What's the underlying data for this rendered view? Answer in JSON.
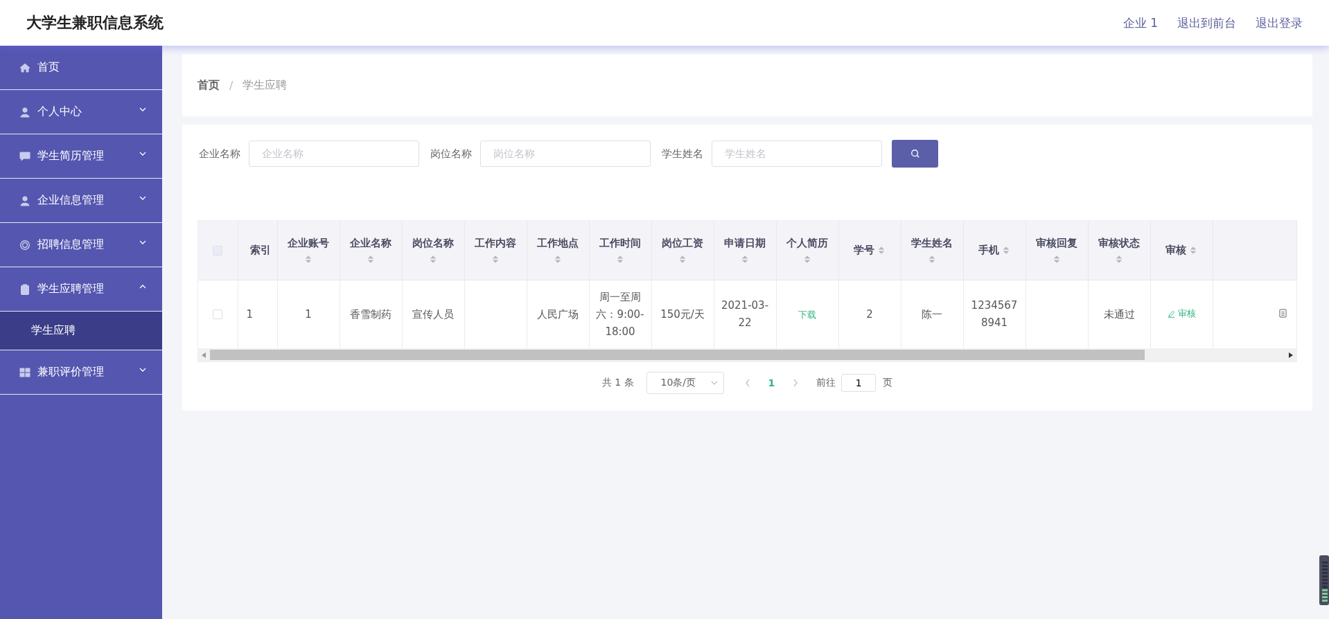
{
  "header": {
    "title": "大学生兼职信息系统",
    "links": [
      "企业 1",
      "退出到前台",
      "退出登录"
    ]
  },
  "sidebar": {
    "items": [
      {
        "label": "首页",
        "has_arrow": false
      },
      {
        "label": "个人中心",
        "expanded": false,
        "has_arrow": true
      },
      {
        "label": "学生简历管理",
        "expanded": false,
        "has_arrow": true
      },
      {
        "label": "企业信息管理",
        "expanded": false,
        "has_arrow": true
      },
      {
        "label": "招聘信息管理",
        "expanded": false,
        "has_arrow": true
      },
      {
        "label": "学生应聘管理",
        "expanded": true,
        "has_arrow": true,
        "children": [
          {
            "label": "学生应聘",
            "selected": true
          }
        ]
      },
      {
        "label": "兼职评价管理",
        "expanded": false,
        "has_arrow": true
      }
    ]
  },
  "breadcrumb": {
    "items": [
      "首页",
      "学生应聘"
    ],
    "separator": "/"
  },
  "search": {
    "fields": [
      {
        "label": "企业名称",
        "placeholder": "企业名称"
      },
      {
        "label": "岗位名称",
        "placeholder": "岗位名称"
      },
      {
        "label": "学生姓名",
        "placeholder": "学生姓名"
      }
    ]
  },
  "table": {
    "select_all_checked": false,
    "columns": [
      {
        "label": "索引",
        "sortable": false
      },
      {
        "label": "企业账号",
        "sortable": true
      },
      {
        "label": "企业名称",
        "sortable": true
      },
      {
        "label": "岗位名称",
        "sortable": true
      },
      {
        "label": "工作内容",
        "sortable": true
      },
      {
        "label": "工作地点",
        "sortable": true
      },
      {
        "label": "工作时间",
        "sortable": true
      },
      {
        "label": "岗位工资",
        "sortable": true
      },
      {
        "label": "申请日期",
        "sortable": true
      },
      {
        "label": "个人简历",
        "sortable": true
      },
      {
        "label": "学号",
        "sortable": true
      },
      {
        "label": "学生姓名",
        "sortable": true
      },
      {
        "label": "手机",
        "sortable": true
      },
      {
        "label": "审核回复",
        "sortable": true
      },
      {
        "label": "审核状态",
        "sortable": true
      },
      {
        "label": "审核",
        "sortable": true
      }
    ],
    "rows": [
      {
        "checked": false,
        "cells": [
          {
            "kind": "text",
            "text": "1"
          },
          {
            "kind": "text",
            "text": "1"
          },
          {
            "kind": "text",
            "text": "香雪制药"
          },
          {
            "kind": "text",
            "text": "宣传人员"
          },
          null,
          {
            "kind": "text",
            "text": "人民广场"
          },
          {
            "kind": "text",
            "text": "周一至周六：9:00-18:00"
          },
          {
            "kind": "text",
            "text": "150元/天"
          },
          {
            "kind": "text",
            "text": "2021-03-22"
          },
          {
            "kind": "link",
            "text": "下载"
          },
          {
            "kind": "text",
            "text": "2"
          },
          {
            "kind": "text",
            "text": "陈一"
          },
          {
            "kind": "text",
            "text": "12345678941"
          },
          null,
          {
            "kind": "text",
            "text": "未通过"
          },
          {
            "kind": "action",
            "text": "审核"
          }
        ]
      }
    ]
  },
  "pagination": {
    "total": "共 1 条",
    "page_size": "10条/页",
    "pages": [
      {
        "label": "1",
        "selected": true
      }
    ],
    "goto_label": "前往",
    "goto_value": "1",
    "goto_suffix": "页"
  }
}
